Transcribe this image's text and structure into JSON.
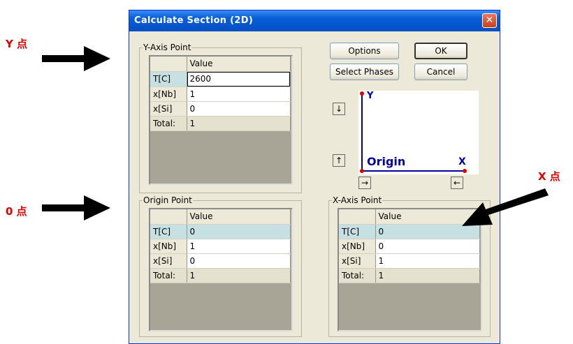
{
  "annotations": {
    "y_point": "Y 点",
    "origin": "0 点",
    "x_point": "X 点"
  },
  "window": {
    "title": "Calculate Section (2D)",
    "close_symbol": "✕"
  },
  "groups": {
    "y_axis": {
      "label": "Y-Axis Point",
      "header": "Value",
      "rows": [
        {
          "label": "T[C]",
          "value": "2600"
        },
        {
          "label": "x[Nb]",
          "value": "1"
        },
        {
          "label": "x[Si]",
          "value": "0"
        },
        {
          "label": "Total:",
          "value": "1"
        }
      ]
    },
    "origin": {
      "label": "Origin Point",
      "header": "Value",
      "rows": [
        {
          "label": "T[C]",
          "value": "0"
        },
        {
          "label": "x[Nb]",
          "value": "1"
        },
        {
          "label": "x[Si]",
          "value": "0"
        },
        {
          "label": "Total:",
          "value": "1"
        }
      ]
    },
    "x_axis": {
      "label": "X-Axis Point",
      "header": "Value",
      "rows": [
        {
          "label": "T[C]",
          "value": "0"
        },
        {
          "label": "x[Nb]",
          "value": "0"
        },
        {
          "label": "x[Si]",
          "value": "1"
        },
        {
          "label": "Total:",
          "value": "1"
        }
      ]
    }
  },
  "buttons": {
    "options": "Options",
    "ok": "OK",
    "select_phases": "Select Phases",
    "cancel": "Cancel"
  },
  "small_buttons": {
    "down": "↓",
    "up": "↑",
    "right": "→",
    "left": "←"
  },
  "preview": {
    "y_label": "Y",
    "x_label": "X",
    "origin_label": "Origin",
    "axis_color": "#0000a0",
    "point_color": "#e00000"
  }
}
